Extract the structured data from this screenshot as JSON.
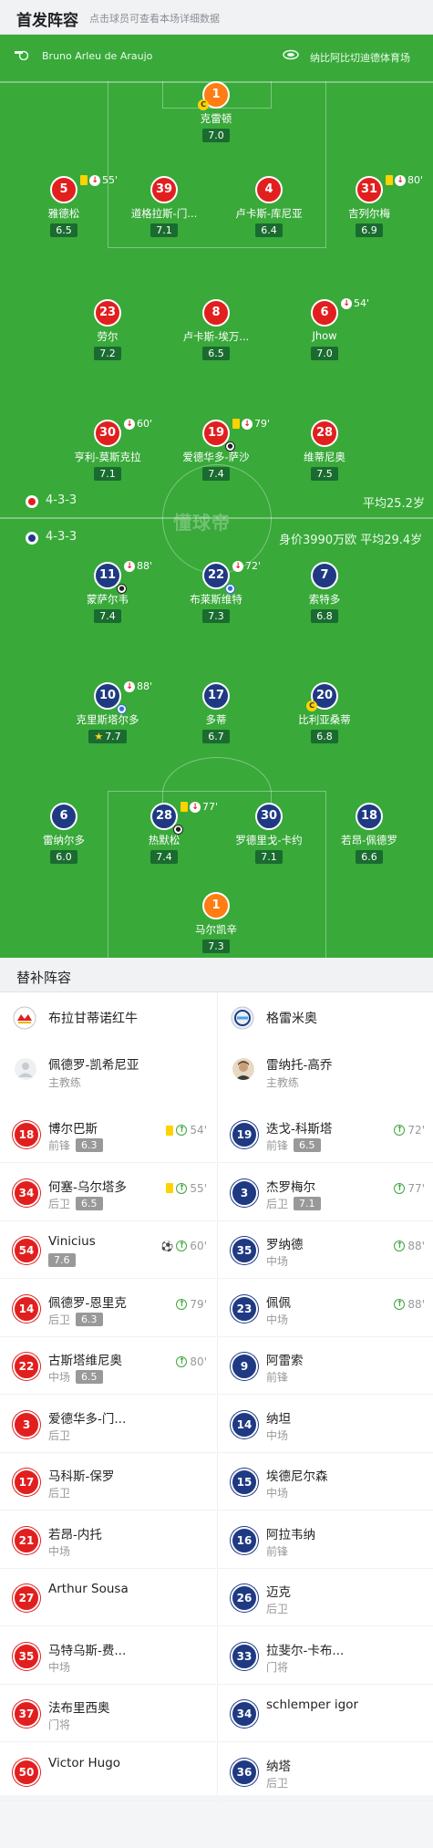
{
  "header": {
    "title": "首发阵容",
    "subtitle": "点击球员可查看本场详细数据"
  },
  "match_info": {
    "referee": "Bruno Arleu de Araujo",
    "stadium": "纳比阿比切迪德体育场"
  },
  "watermark": "懂球帝",
  "home": {
    "name": "布拉甘蒂诺红牛",
    "formation": "4-3-3",
    "avg_age": "平均25.2岁",
    "players": [
      {
        "num": "1",
        "name": "克雷顿",
        "rating": "7.0"
      },
      {
        "num": "5",
        "name": "雅德松",
        "rating": "6.5",
        "event": "55'"
      },
      {
        "num": "39",
        "name": "道格拉斯-门...",
        "rating": "7.1"
      },
      {
        "num": "4",
        "name": "卢卡斯-库尼亚",
        "rating": "6.4"
      },
      {
        "num": "31",
        "name": "吉列尔梅",
        "rating": "6.9",
        "event": "80'"
      },
      {
        "num": "23",
        "name": "劳尔",
        "rating": "7.2"
      },
      {
        "num": "8",
        "name": "卢卡斯-埃万...",
        "rating": "6.5"
      },
      {
        "num": "6",
        "name": "Jhow",
        "rating": "7.0",
        "event": "54'"
      },
      {
        "num": "30",
        "name": "亨利-莫斯克拉",
        "rating": "7.1",
        "event": "60'"
      },
      {
        "num": "19",
        "name": "爱德华多-萨沙",
        "rating": "7.4",
        "event": "79'"
      },
      {
        "num": "28",
        "name": "维蒂尼奥",
        "rating": "7.5"
      }
    ],
    "coach": {
      "name": "佩德罗-凯希尼亚",
      "role": "主教练"
    },
    "subs": [
      {
        "num": "18",
        "name": "博尔巴斯",
        "pos": "前锋",
        "rating": "6.3",
        "event": "54'",
        "yellow": true
      },
      {
        "num": "34",
        "name": "何塞-乌尔塔多",
        "pos": "后卫",
        "rating": "6.5",
        "event": "55'",
        "yellow": true
      },
      {
        "num": "54",
        "name": "Vinicius",
        "pos": "",
        "rating": "7.6",
        "event": "60'",
        "goal": true
      },
      {
        "num": "14",
        "name": "佩德罗-恩里克",
        "pos": "后卫",
        "rating": "6.3",
        "event": "79'"
      },
      {
        "num": "22",
        "name": "古斯塔维尼奥",
        "pos": "中场",
        "rating": "6.5",
        "event": "80'"
      },
      {
        "num": "3",
        "name": "爱德华多-门...",
        "pos": "后卫"
      },
      {
        "num": "17",
        "name": "马科斯-保罗",
        "pos": "后卫"
      },
      {
        "num": "21",
        "name": "若昂-内托",
        "pos": "中场"
      },
      {
        "num": "27",
        "name": "Arthur Sousa",
        "pos": ""
      },
      {
        "num": "35",
        "name": "马特乌斯-费...",
        "pos": "中场"
      },
      {
        "num": "37",
        "name": "法布里西奥",
        "pos": "门将"
      },
      {
        "num": "50",
        "name": "Victor Hugo",
        "pos": ""
      }
    ]
  },
  "away": {
    "name": "格雷米奥",
    "formation": "4-3-3",
    "value_age": "身价3990万欧 平均29.4岁",
    "players": [
      {
        "num": "11",
        "name": "蒙萨尔韦",
        "rating": "7.4",
        "event": "88'"
      },
      {
        "num": "22",
        "name": "布莱斯维特",
        "rating": "7.3",
        "event": "72'"
      },
      {
        "num": "7",
        "name": "索特多",
        "rating": "6.8"
      },
      {
        "num": "10",
        "name": "克里斯塔尔多",
        "rating": "7.7",
        "event": "88'"
      },
      {
        "num": "17",
        "name": "多蒂",
        "rating": "6.7"
      },
      {
        "num": "20",
        "name": "比利亚桑蒂",
        "rating": "6.8"
      },
      {
        "num": "6",
        "name": "雷纳尔多",
        "rating": "6.0"
      },
      {
        "num": "28",
        "name": "热默松",
        "rating": "7.4",
        "event": "77'"
      },
      {
        "num": "30",
        "name": "罗德里戈-卡约",
        "rating": "7.1"
      },
      {
        "num": "18",
        "name": "若昂-佩德罗",
        "rating": "6.6"
      },
      {
        "num": "1",
        "name": "马尔凯辛",
        "rating": "7.3"
      }
    ],
    "coach": {
      "name": "雷纳托-高乔",
      "role": "主教练"
    },
    "subs": [
      {
        "num": "19",
        "name": "迭戈-科斯塔",
        "pos": "前锋",
        "rating": "6.5",
        "event": "72'"
      },
      {
        "num": "3",
        "name": "杰罗梅尔",
        "pos": "后卫",
        "rating": "7.1",
        "event": "77'"
      },
      {
        "num": "35",
        "name": "罗纳德",
        "pos": "中场",
        "event": "88'"
      },
      {
        "num": "23",
        "name": "佩佩",
        "pos": "中场",
        "event": "88'"
      },
      {
        "num": "9",
        "name": "阿雷索",
        "pos": "前锋"
      },
      {
        "num": "14",
        "name": "纳坦",
        "pos": "中场"
      },
      {
        "num": "15",
        "name": "埃德尼尔森",
        "pos": "中场"
      },
      {
        "num": "16",
        "name": "阿拉韦纳",
        "pos": "前锋"
      },
      {
        "num": "26",
        "name": "迈克",
        "pos": "后卫"
      },
      {
        "num": "33",
        "name": "拉斐尔-卡布...",
        "pos": "门将"
      },
      {
        "num": "34",
        "name": "schlemper igor",
        "pos": ""
      },
      {
        "num": "36",
        "name": "纳塔",
        "pos": "后卫"
      }
    ]
  },
  "bench_title": "替补阵容",
  "colors": {
    "pitch": "#39a93a",
    "home": "#e21f1f",
    "away": "#1f3a83",
    "keeper": "#ff7d13"
  }
}
